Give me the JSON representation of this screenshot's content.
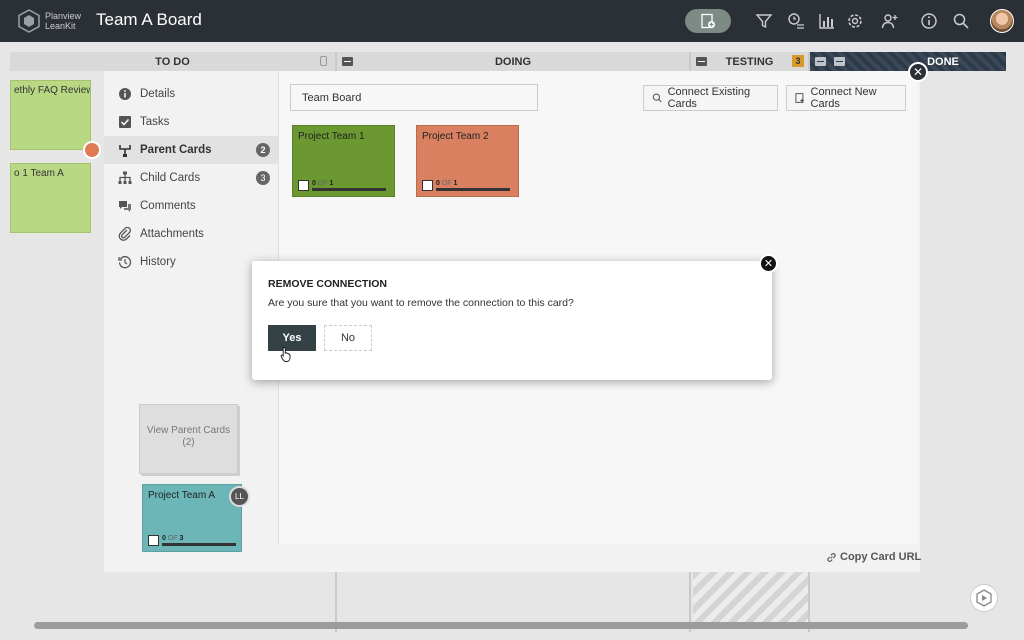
{
  "topbar": {
    "logo_line1": "Planview",
    "logo_line2": "LeanKit",
    "board_title": "Team A Board"
  },
  "columns": {
    "todo": "TO DO",
    "doing": "DOING",
    "testing": "TESTING",
    "testing_wip": "3",
    "done": "DONE"
  },
  "background_cards": [
    {
      "label": "ethly FAQ Review"
    },
    {
      "label": "o 1 Team A"
    }
  ],
  "nav": {
    "items": [
      {
        "label": "Details",
        "icon": "info-icon"
      },
      {
        "label": "Tasks",
        "icon": "checkbox-icon"
      },
      {
        "label": "Parent Cards",
        "icon": "parent-hierarchy-icon",
        "badge": "2"
      },
      {
        "label": "Child Cards",
        "icon": "child-hierarchy-icon",
        "badge": "3"
      },
      {
        "label": "Comments",
        "icon": "comments-icon"
      },
      {
        "label": "Attachments",
        "icon": "paperclip-icon"
      },
      {
        "label": "History",
        "icon": "history-icon"
      }
    ]
  },
  "search": {
    "value": "Team Board"
  },
  "buttons": {
    "connect_existing": "Connect Existing Cards",
    "connect_new": "Connect New Cards",
    "copy_url": "Copy Card URL"
  },
  "parent_cards": [
    {
      "title": "Project Team 1",
      "done": "0",
      "of": "OF",
      "total": "1",
      "color": "#6b9830"
    },
    {
      "title": "Project Team 2",
      "done": "0",
      "of": "OF",
      "total": "1",
      "color": "#d8805f"
    }
  ],
  "view_parent": {
    "line1": "View Parent Cards",
    "line2": "(2)"
  },
  "current_card": {
    "title": "Project Team A",
    "done": "0",
    "of": "OF",
    "total": "3",
    "assignee": "LL"
  },
  "modal": {
    "title": "REMOVE CONNECTION",
    "message": "Are you sure that you want to remove the connection to this card?",
    "yes": "Yes",
    "no": "No"
  }
}
